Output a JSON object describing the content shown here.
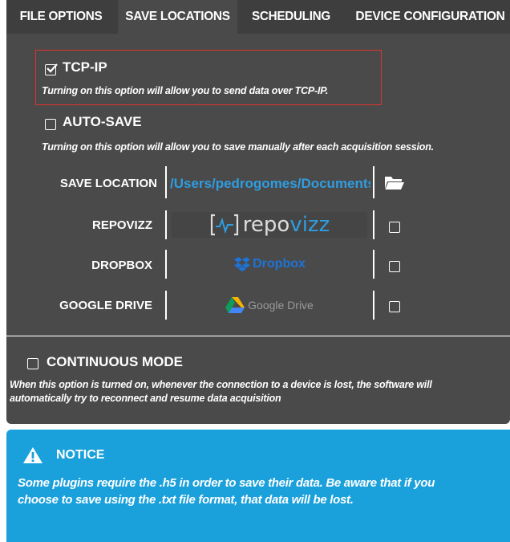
{
  "tabs": [
    {
      "label": "FILE OPTIONS"
    },
    {
      "label": "SAVE LOCATIONS",
      "active": true
    },
    {
      "label": "SCHEDULING"
    },
    {
      "label": "DEVICE CONFIGURATION"
    }
  ],
  "tcp": {
    "title": "TCP-IP",
    "checked": true,
    "description": "Turning on this option will allow you to send data over TCP-IP."
  },
  "autosave": {
    "title": "AUTO-SAVE",
    "checked": false,
    "description": "Turning on this option will allow you to save manually after each acquisition session."
  },
  "save_location": {
    "label": "SAVE LOCATION",
    "path": "/Users/pedrogomes/Documents",
    "icon": "folder-open-icon"
  },
  "services": [
    {
      "label": "REPOVIZZ",
      "logo_prefix": "repo",
      "logo_suffix": "vizz",
      "checked": false
    },
    {
      "label": "DROPBOX",
      "logo": "Dropbox",
      "checked": false
    },
    {
      "label": "GOOGLE DRIVE",
      "logo": "Google Drive",
      "checked": false
    }
  ],
  "continuous": {
    "title": "CONTINUOUS MODE",
    "checked": false,
    "description_line1": "When this option is turned on, whenever the connection to a device is lost, the software will",
    "description_line2": "automatically try to reconnect and resume data acquisition"
  },
  "notice": {
    "title": "NOTICE",
    "text_line1": "Some plugins require the .h5 in order to save their data. Be aware that if you",
    "text_line2": "choose to save using the .txt file format, that data will be lost."
  },
  "colors": {
    "panel": "#4a4a4a",
    "tabbar": "#3e3e3e",
    "accent_blue": "#1aa0db",
    "path_blue": "#2f9de0",
    "highlight_red": "#e0332b"
  }
}
